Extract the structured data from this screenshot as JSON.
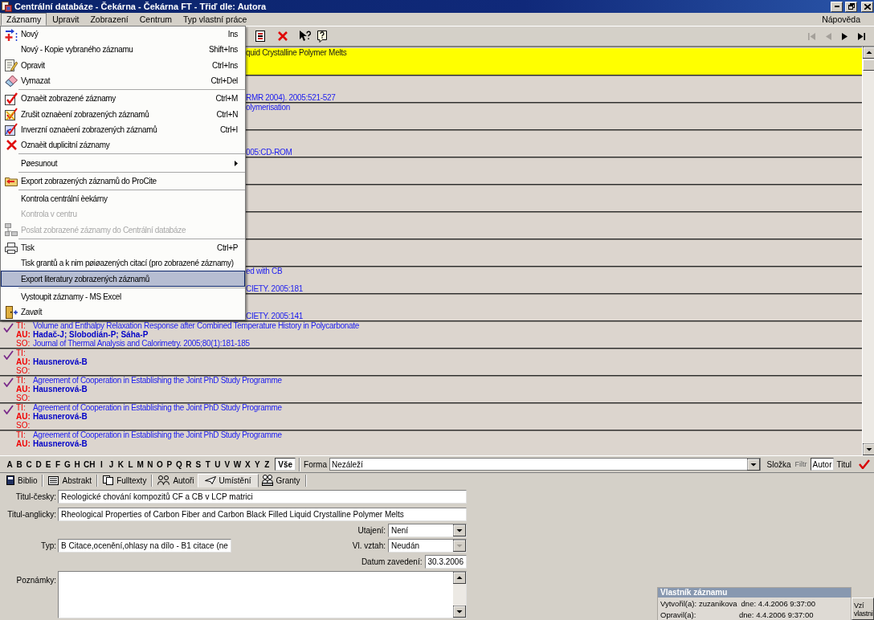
{
  "window": {
    "title": "Centrální databáze - Čekárna - Čekárna FT - Třiď dle: Autora"
  },
  "menu_bar": {
    "items": [
      {
        "label": "Záznamy",
        "selected": true
      },
      {
        "label": "Upravit",
        "selected": false
      },
      {
        "label": "Zobrazení",
        "selected": false
      },
      {
        "label": "Centrum",
        "selected": false
      },
      {
        "label": "Typ vlastní práce",
        "selected": false
      }
    ],
    "help": {
      "label": "Nápověda",
      "selected": false
    }
  },
  "open_menu": {
    "items": [
      {
        "kind": "item",
        "label": "Nový",
        "shortcut": "Ins",
        "selected": false,
        "disabled": false
      },
      {
        "kind": "item",
        "label": "Nový - Kopie vybraného záznamu",
        "shortcut": "Shift+Ins",
        "selected": false,
        "disabled": false
      },
      {
        "kind": "item",
        "label": "Opravit",
        "shortcut": "Ctrl+Ins",
        "selected": false,
        "disabled": false
      },
      {
        "kind": "item",
        "label": "Vymazat",
        "shortcut": "Ctrl+Del",
        "selected": false,
        "disabled": false
      },
      {
        "kind": "separator"
      },
      {
        "kind": "item",
        "label": "Oznaèit zobrazené záznamy",
        "shortcut": "Ctrl+M",
        "selected": false,
        "disabled": false
      },
      {
        "kind": "item",
        "label": "Zrušit oznaèení zobrazených záznamů",
        "shortcut": "Ctrl+N",
        "selected": false,
        "disabled": false
      },
      {
        "kind": "item",
        "label": "Inverzní oznaèení zobrazených záznamů",
        "shortcut": "Ctrl+I",
        "selected": false,
        "disabled": false
      },
      {
        "kind": "item",
        "label": "Oznaèit duplicitní záznamy",
        "selected": false,
        "disabled": false
      },
      {
        "kind": "separator"
      },
      {
        "kind": "submenu",
        "label": "Pøesunout",
        "selected": false,
        "disabled": false
      },
      {
        "kind": "separator"
      },
      {
        "kind": "item",
        "label": "Export zobrazených záznamů do ProCite",
        "selected": false,
        "disabled": false
      },
      {
        "kind": "separator"
      },
      {
        "kind": "item",
        "label": "Kontrola centrální èekárny",
        "selected": false,
        "disabled": false
      },
      {
        "kind": "item",
        "label": "Kontrola v centru",
        "selected": false,
        "disabled": true
      },
      {
        "kind": "item",
        "label": "Poslat zobrazené záznamy do Centrální databáze",
        "selected": false,
        "disabled": true
      },
      {
        "kind": "separator"
      },
      {
        "kind": "item",
        "label": "Tisk",
        "shortcut": "Ctrl+P",
        "selected": false,
        "disabled": false
      },
      {
        "kind": "item",
        "label": "Tisk grantů a k nim pøiøazených citací (pro zobrazené záznamy)",
        "selected": false,
        "disabled": false
      },
      {
        "kind": "item",
        "label": "Export literatury zobrazených záznamů",
        "selected": true,
        "disabled": false
      },
      {
        "kind": "separator"
      },
      {
        "kind": "item",
        "label": "Vystoupit záznamy - MS Excel",
        "selected": false,
        "disabled": false
      },
      {
        "kind": "item",
        "label": "Zavøít",
        "selected": false,
        "disabled": false
      }
    ]
  },
  "toolbar": {
    "nav_buttons": [
      {
        "disabled": true
      },
      {
        "disabled": true
      },
      {
        "disabled": false
      },
      {
        "disabled": false
      }
    ]
  },
  "records": [
    {
      "selected": true,
      "marked": false,
      "lines": [
        {
          "kind": "ti",
          "text": "quid Crystalline Polymer Melts"
        }
      ]
    },
    {
      "selected": false,
      "marked": false,
      "lines": [
        {
          "kind": "so",
          "text": "RMR 2004). 2005:521-527"
        }
      ]
    },
    {
      "selected": false,
      "marked": false,
      "lines": [
        {
          "kind": "ti",
          "text": "olymerisation"
        }
      ]
    },
    {
      "selected": false,
      "marked": false,
      "lines": [
        {
          "kind": "so",
          "text": "005:CD-ROM"
        }
      ]
    },
    {
      "selected": false,
      "marked": false
    },
    {
      "selected": false,
      "marked": false
    },
    {
      "selected": false,
      "marked": false
    },
    {
      "selected": false,
      "marked": false
    },
    {
      "selected": false,
      "marked": false,
      "lines": [
        {
          "kind": "ti",
          "text": "ed with CB"
        },
        {
          "kind": "so",
          "text": "CIETY. 2005:181"
        }
      ]
    },
    {
      "selected": false,
      "marked": false,
      "lines": [
        {
          "kind": "so",
          "text": "CIETY. 2005:141"
        }
      ]
    },
    {
      "selected": false,
      "marked": true,
      "lines": [
        {
          "kind": "ti",
          "label": "TI:",
          "text": "Volume and Enthalpy Relaxation Response after Combined Temperature History in Polycarbonate"
        },
        {
          "kind": "au",
          "label": "AU:",
          "text": "Hadač-J; Slobodián-P; Sáha-P"
        },
        {
          "kind": "so",
          "label": "SO:",
          "text": "Journal of Thermal Analysis and Calorimetry. 2005;80(1):181-185"
        }
      ]
    },
    {
      "selected": false,
      "marked": true,
      "lines": [
        {
          "kind": "ti",
          "label": "TI:"
        },
        {
          "kind": "au",
          "label": "AU:",
          "text": "Hausnerová-B"
        },
        {
          "kind": "so",
          "label": "SO:"
        }
      ]
    },
    {
      "selected": false,
      "marked": true,
      "lines": [
        {
          "kind": "ti",
          "label": "TI:",
          "text": "Agreement of Cooperation in Establishing the Joint PhD Study Programme"
        },
        {
          "kind": "au",
          "label": "AU:",
          "text": "Hausnerová-B"
        },
        {
          "kind": "so",
          "label": "SO:"
        }
      ]
    },
    {
      "selected": false,
      "marked": true,
      "lines": [
        {
          "kind": "ti",
          "label": "TI:",
          "text": "Agreement of Cooperation in Establishing the Joint PhD Study Programme"
        },
        {
          "kind": "au",
          "label": "AU:",
          "text": "Hausnerová-B"
        },
        {
          "kind": "so",
          "label": "SO:"
        }
      ]
    },
    {
      "selected": false,
      "marked": false,
      "lines": [
        {
          "kind": "ti",
          "label": "TI:",
          "text": "Agreement of Cooperation in Establishing the Joint PhD Study Programme"
        },
        {
          "kind": "au",
          "label": "AU:",
          "text": "Hausnerová-B"
        }
      ]
    }
  ],
  "filter_bar": {
    "letters": [
      {
        "label": "A",
        "selected": false
      },
      {
        "label": "B",
        "selected": false
      },
      {
        "label": "C",
        "selected": false
      },
      {
        "label": "D",
        "selected": false
      },
      {
        "label": "E",
        "selected": false
      },
      {
        "label": "F",
        "selected": false
      },
      {
        "label": "G",
        "selected": false
      },
      {
        "label": "H",
        "selected": false
      },
      {
        "label": "CH",
        "selected": false
      },
      {
        "label": "I",
        "selected": false
      },
      {
        "label": "J",
        "selected": false
      },
      {
        "label": "K",
        "selected": false
      },
      {
        "label": "L",
        "selected": false
      },
      {
        "label": "M",
        "selected": false
      },
      {
        "label": "N",
        "selected": false
      },
      {
        "label": "O",
        "selected": false
      },
      {
        "label": "P",
        "selected": false
      },
      {
        "label": "Q",
        "selected": false
      },
      {
        "label": "R",
        "selected": false
      },
      {
        "label": "S",
        "selected": false
      },
      {
        "label": "T",
        "selected": false
      },
      {
        "label": "U",
        "selected": false
      },
      {
        "label": "V",
        "selected": false
      },
      {
        "label": "W",
        "selected": false
      },
      {
        "label": "X",
        "selected": false
      },
      {
        "label": "Y",
        "selected": false
      },
      {
        "label": "Z",
        "selected": false
      },
      {
        "label": "Vše",
        "selected": true
      }
    ],
    "form_label": "Forma",
    "form_value": "Nezáleží",
    "folder_label": "Složka",
    "filter": {
      "label": "Filtr",
      "disabled": true
    },
    "sort": [
      {
        "label": "Autor",
        "selected": true
      },
      {
        "label": "Titul",
        "selected": false
      }
    ]
  },
  "tabs": [
    {
      "label": "Biblio",
      "selected": false
    },
    {
      "label": "Abstrakt",
      "selected": false
    },
    {
      "label": "Fulltexty",
      "selected": false
    },
    {
      "label": "Autoři",
      "selected": false
    },
    {
      "label": "Umístění",
      "selected": true
    },
    {
      "label": "Granty",
      "selected": false
    }
  ],
  "form": {
    "title_cz": {
      "label": "Titul-česky:",
      "value": "Reologické chování kompozitů CF a CB v LCP matrici"
    },
    "title_en": {
      "label": "Titul-anglicky:",
      "value": "Rheological Properties of Carbon Fiber and Carbon Black Filled Liquid Crystalline Polymer Melts"
    },
    "secrecy": {
      "label": "Utajení:",
      "value": "Není",
      "disabled": false
    },
    "type": {
      "label": "Typ:",
      "value": "B Citace,ocenění,ohlasy na dílo - B1 citace (ne"
    },
    "relation": {
      "label": "Vl. vztah:",
      "value": "Neudán",
      "disabled": true
    },
    "date": {
      "label": "Datum zavedení:",
      "value": "30.3.2006"
    },
    "notes": {
      "label": "Poznámky:"
    }
  },
  "owner": {
    "title": "Vlastník záznamu",
    "rows": [
      {
        "label": "Vytvořil(a):",
        "value": "zuzanikova",
        "date": "dne: 4.4.2006 9:37:00"
      },
      {
        "label": "Opravil(a):",
        "date": "dne: 4.4.2006 9:37:00"
      }
    ],
    "button": "Vzí\nvlastni"
  }
}
